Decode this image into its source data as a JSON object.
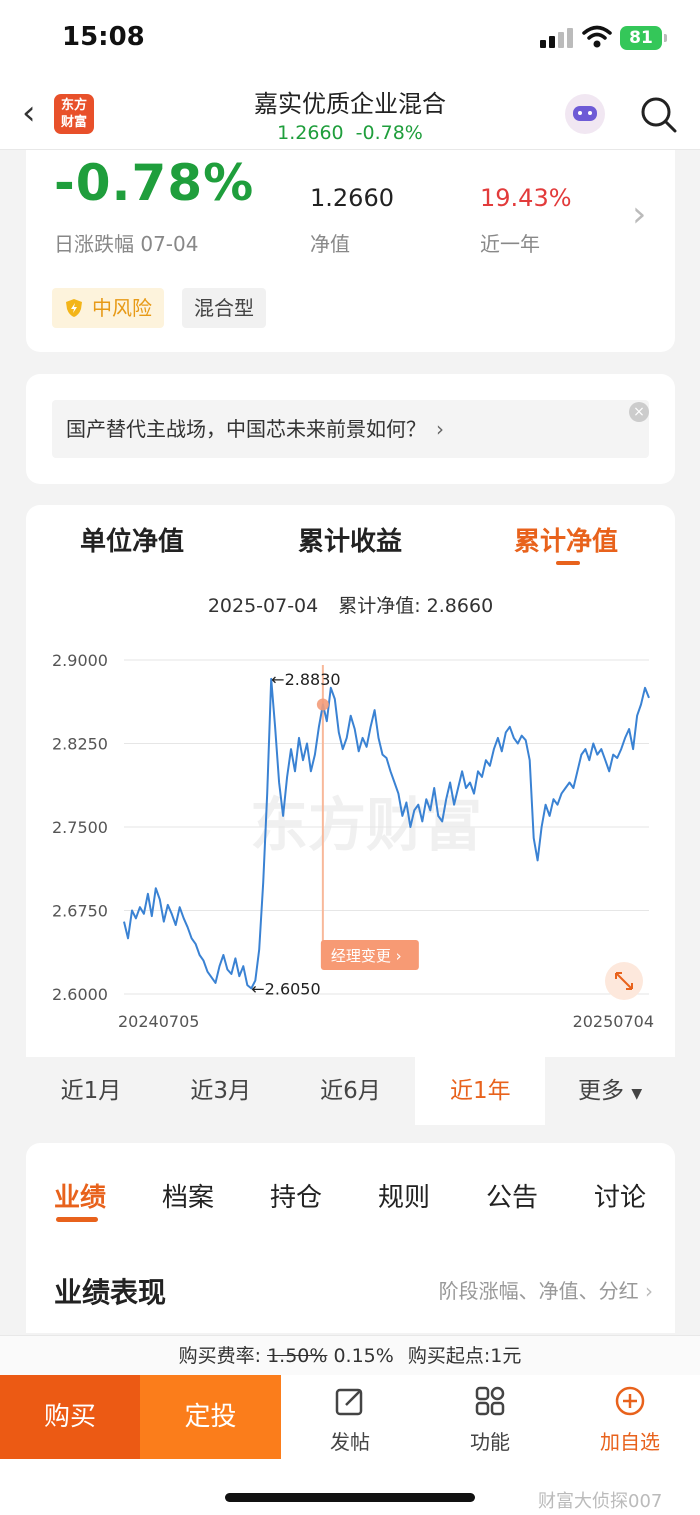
{
  "status": {
    "time": "15:08",
    "battery": "81"
  },
  "nav": {
    "back_icon": "chevron-left-icon",
    "logo_text": "东方财富",
    "title": "嘉实优质企业混合",
    "nav_value": "1.2660",
    "nav_change": "-0.78%"
  },
  "summary": {
    "daily_change": "-0.78%",
    "daily_change_label": "日涨跌幅 07-04",
    "nav_value": "1.2660",
    "nav_label": "净值",
    "one_year": "19.43%",
    "one_year_label": "近一年",
    "risk_tag": "中风险",
    "type_tag": "混合型",
    "colors": {
      "down": "#1f9e3c",
      "up": "#e23b3b",
      "accent": "#e8621c"
    }
  },
  "banner": {
    "text": "国产替代主战场，中国芯未来前景如何？",
    "close_icon": "close-icon"
  },
  "chart_tabs": [
    "单位净值",
    "累计收益",
    "累计净值"
  ],
  "chart_tab_active": 2,
  "chart_info": {
    "date": "2025-07-04",
    "value_text": "累计净值: 2.8660"
  },
  "chart_data": {
    "type": "line",
    "y_ticks": [
      "2.9000",
      "2.8250",
      "2.7500",
      "2.6750",
      "2.6000"
    ],
    "ylim": [
      2.6,
      2.9
    ],
    "x_start_label": "20240705",
    "x_end_label": "20250704",
    "max_label": "2.8830",
    "min_label": "2.6050",
    "max_value": 2.883,
    "min_value": 2.605,
    "event_label": "经理变更",
    "watermark": "东方财富",
    "series": [
      {
        "values": [
          2.665,
          2.65,
          2.675,
          2.668,
          2.678,
          2.672,
          2.69,
          2.67,
          2.695,
          2.685,
          2.665,
          2.68,
          2.672,
          2.662,
          2.678,
          2.668,
          2.66,
          2.65,
          2.645,
          2.635,
          2.63,
          2.62,
          2.615,
          2.61,
          2.625,
          2.635,
          2.622,
          2.618,
          2.632,
          2.616,
          2.625,
          2.608,
          2.605,
          2.612,
          2.64,
          2.7,
          2.78,
          2.883,
          2.84,
          2.79,
          2.76,
          2.795,
          2.82,
          2.8,
          2.83,
          2.81,
          2.825,
          2.8,
          2.815,
          2.84,
          2.86,
          2.845,
          2.875,
          2.865,
          2.835,
          2.82,
          2.83,
          2.85,
          2.838,
          2.818,
          2.83,
          2.822,
          2.84,
          2.855,
          2.83,
          2.815,
          2.812,
          2.8,
          2.79,
          2.78,
          2.76,
          2.772,
          2.75,
          2.765,
          2.77,
          2.755,
          2.775,
          2.765,
          2.785,
          2.76,
          2.755,
          2.775,
          2.79,
          2.77,
          2.785,
          2.8,
          2.785,
          2.79,
          2.78,
          2.8,
          2.795,
          2.81,
          2.805,
          2.82,
          2.83,
          2.818,
          2.835,
          2.84,
          2.83,
          2.825,
          2.832,
          2.828,
          2.81,
          2.74,
          2.72,
          2.75,
          2.77,
          2.76,
          2.775,
          2.77,
          2.78,
          2.785,
          2.79,
          2.785,
          2.8,
          2.815,
          2.82,
          2.81,
          2.825,
          2.815,
          2.82,
          2.81,
          2.8,
          2.815,
          2.812,
          2.82,
          2.83,
          2.838,
          2.82,
          2.85,
          2.86,
          2.875,
          2.866
        ]
      }
    ]
  },
  "periods": [
    "近1月",
    "近3月",
    "近6月",
    "近1年",
    "更多"
  ],
  "period_active": 3,
  "detail_tabs": [
    "业绩",
    "档案",
    "持仓",
    "规则",
    "公告",
    "讨论"
  ],
  "detail_tab_active": 0,
  "performance": {
    "title": "业绩表现",
    "link": "阶段涨幅、净值、分红"
  },
  "fee": {
    "label": "购买费率:",
    "original": "1.50%",
    "current": "0.15%",
    "min_purchase": "购买起点:1元"
  },
  "bottom": {
    "buy": "购买",
    "sip": "定投",
    "post": "发帖",
    "functions": "功能",
    "add_watch": "加自选"
  },
  "watermark_text": "财富大侦探007"
}
